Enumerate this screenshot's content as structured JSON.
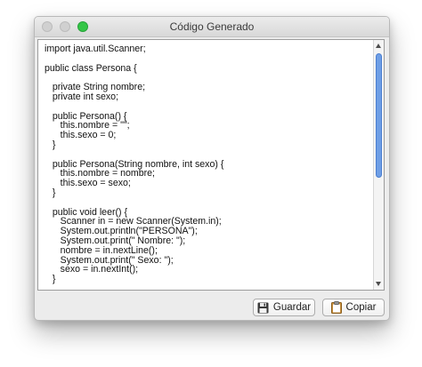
{
  "window": {
    "title": "Código Generado"
  },
  "editor": {
    "lines": [
      "import java.util.Scanner;",
      "",
      "public class Persona {",
      "",
      "   private String nombre;",
      "   private int sexo;",
      "",
      "   public Persona() {",
      "      this.nombre = \"\";",
      "      this.sexo = 0;",
      "   }",
      "",
      "   public Persona(String nombre, int sexo) {",
      "      this.nombre = nombre;",
      "      this.sexo = sexo;",
      "   }",
      "",
      "   public void leer() {",
      "      Scanner in = new Scanner(System.in);",
      "      System.out.println(\"PERSONA\");",
      "      System.out.print(\" Nombre: \");",
      "      nombre = in.nextLine();",
      "      System.out.print(\" Sexo: \");",
      "      sexo = in.nextInt();",
      "   }"
    ]
  },
  "buttons": {
    "save_label": "Guardar",
    "save_icon": "floppy-disk-icon",
    "copy_label": "Copiar",
    "copy_icon": "clipboard-icon"
  },
  "colors": {
    "close_button": "#d0d0d0",
    "minimize_button": "#d0d0d0",
    "zoom_button": "#35c647",
    "scroll_thumb": "#6f9fe6"
  }
}
